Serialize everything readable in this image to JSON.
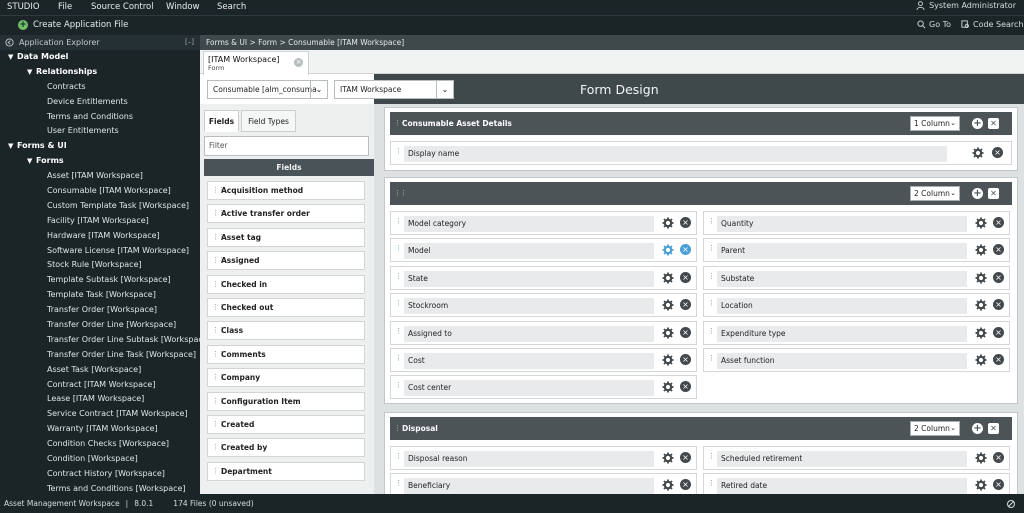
{
  "menubar": {
    "items": [
      "STUDIO",
      "File",
      "Source Control",
      "Window",
      "Search"
    ],
    "user": "System Administrator"
  },
  "toolbar": {
    "create_label": "Create Application File",
    "goto_label": "Go To",
    "codesearch_label": "Code Search"
  },
  "sidebar": {
    "title": "Application Explorer",
    "collapse_label": "[–]",
    "tree": [
      {
        "label": "Data Model",
        "level": 0,
        "bold": true,
        "expanded": true
      },
      {
        "label": "Relationships",
        "level": 1,
        "bold": true,
        "expanded": true
      },
      {
        "label": "Contracts",
        "level": 2
      },
      {
        "label": "Device Entitlements",
        "level": 2
      },
      {
        "label": "Terms and Conditions",
        "level": 2
      },
      {
        "label": "User Entitlements",
        "level": 2
      },
      {
        "label": "Forms & UI",
        "level": 0,
        "bold": true,
        "expanded": true
      },
      {
        "label": "Forms",
        "level": 1,
        "bold": true,
        "expanded": true
      },
      {
        "label": "Asset [ITAM Workspace]",
        "level": 2
      },
      {
        "label": "Consumable [ITAM Workspace]",
        "level": 2
      },
      {
        "label": "Custom Template Task [Workspace]",
        "level": 2
      },
      {
        "label": "Facility [ITAM Workspace]",
        "level": 2
      },
      {
        "label": "Hardware [ITAM Workspace]",
        "level": 2
      },
      {
        "label": "Software License [ITAM Workspace]",
        "level": 2
      },
      {
        "label": "Stock Rule [Workspace]",
        "level": 2
      },
      {
        "label": "Template Subtask [Workspace]",
        "level": 2
      },
      {
        "label": "Template Task [Workspace]",
        "level": 2
      },
      {
        "label": "Transfer Order [Workspace]",
        "level": 2
      },
      {
        "label": "Transfer Order Line [Workspace]",
        "level": 2
      },
      {
        "label": "Transfer Order Line Subtask [Workspace]",
        "level": 2
      },
      {
        "label": "Transfer Order Line Task [Workspace]",
        "level": 2
      },
      {
        "label": "Asset Task [Workspace]",
        "level": 2
      },
      {
        "label": "Contract [ITAM Workspace]",
        "level": 2
      },
      {
        "label": "Lease [ITAM Workspace]",
        "level": 2
      },
      {
        "label": "Service Contract [ITAM Workspace]",
        "level": 2
      },
      {
        "label": "Warranty [ITAM Workspace]",
        "level": 2
      },
      {
        "label": "Condition Checks [Workspace]",
        "level": 2
      },
      {
        "label": "Condition [Workspace]",
        "level": 2
      },
      {
        "label": "Contract History [Workspace]",
        "level": 2
      },
      {
        "label": "Terms and Conditions [Workspace]",
        "level": 2
      }
    ]
  },
  "breadcrumb": "Forms & UI > Form > Consumable [ITAM Workspace]",
  "tab": {
    "title": "[ITAM Workspace]",
    "subtitle": "Form"
  },
  "selectors": {
    "table": "Consumable [alm_consuma",
    "view": "ITAM Workspace"
  },
  "form_title": "Form Design",
  "left_tabs": [
    "Fields",
    "Field Types"
  ],
  "filter_placeholder": "Filter",
  "fields_header": "Fields",
  "fields": [
    "Acquisition method",
    "Active transfer order",
    "Asset tag",
    "Assigned",
    "Checked in",
    "Checked out",
    "Class",
    "Comments",
    "Company",
    "Configuration Item",
    "Created",
    "Created by",
    "Department"
  ],
  "sections": [
    {
      "title": "Consumable Asset Details",
      "columns": "1 Column",
      "left": [
        "Display name"
      ],
      "right": []
    },
    {
      "title": "",
      "columns": "2 Column",
      "left": [
        "Model category",
        "Model",
        "State",
        "Stockroom",
        "Assigned to",
        "Cost",
        "Cost center"
      ],
      "right": [
        "Quantity",
        "Parent",
        "Substate",
        "Location",
        "Expenditure type",
        "Asset function"
      ]
    },
    {
      "title": "Disposal",
      "columns": "2 Column",
      "left": [
        "Disposal reason",
        "Beneficiary"
      ],
      "right": [
        "Scheduled retirement",
        "Retired date"
      ]
    }
  ],
  "status": {
    "app": "Asset Management Workspace",
    "version": "8.0.1",
    "files": "174 Files (0 unsaved)"
  }
}
